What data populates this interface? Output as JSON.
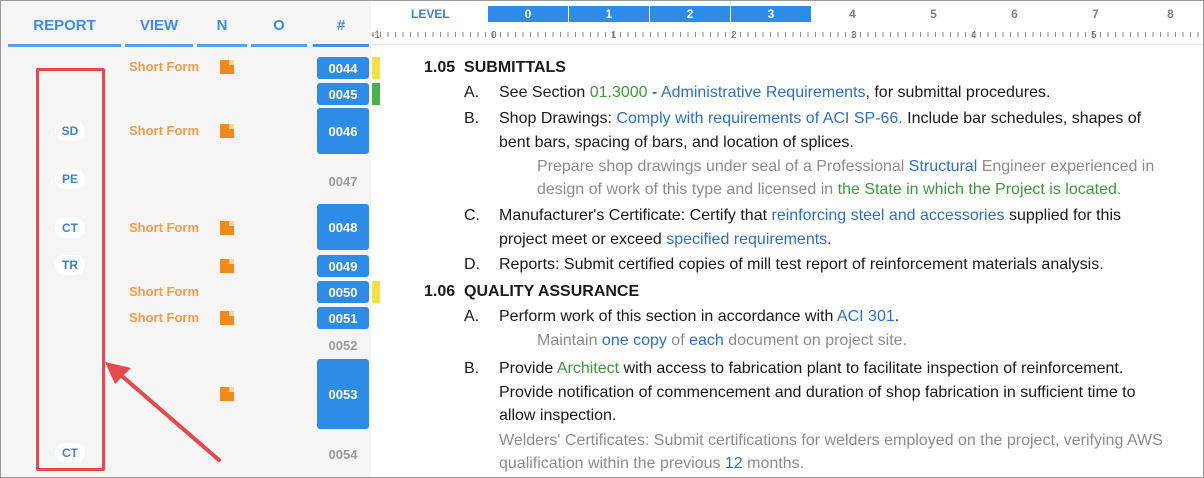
{
  "columns": {
    "report": "REPORT",
    "view": "VIEW",
    "n": "N",
    "o": "O",
    "number": "#"
  },
  "level_bar": {
    "title": "LEVEL",
    "active": [
      "0",
      "1",
      "2",
      "3"
    ],
    "inactive": [
      "4",
      "5",
      "6",
      "7",
      "8"
    ]
  },
  "ruler_labels": [
    "-1",
    "0",
    "1",
    "2",
    "3",
    "4",
    "5"
  ],
  "rows": {
    "r0044": {
      "num": "0044",
      "view": "Short Form",
      "flag": "#f2e24a"
    },
    "r0045": {
      "num": "0045",
      "flag": "#4cae4c"
    },
    "r0046": {
      "num": "0046",
      "report": "SD",
      "view": "Short Form"
    },
    "r0047": {
      "num": "0047",
      "report": "PE"
    },
    "r0048": {
      "num": "0048",
      "report": "CT",
      "view": "Short Form"
    },
    "r0049": {
      "num": "0049",
      "report": "TR"
    },
    "r0050": {
      "num": "0050",
      "view": "Short Form",
      "flag": "#f2e24a"
    },
    "r0051": {
      "num": "0051",
      "view": "Short Form"
    },
    "r0052": {
      "num": "0052"
    },
    "r0053": {
      "num": "0053"
    },
    "r0054": {
      "num": "0054",
      "report": "CT"
    }
  },
  "doc": {
    "s105": {
      "num": "1.05",
      "title": "SUBMITTALS"
    },
    "a": {
      "letter": "A.",
      "t1": "See Section ",
      "t2": "01.3000",
      "t3": " - ",
      "t4": "Administrative Requirements",
      "t5": ", for submittal procedures."
    },
    "b": {
      "letter": "B.",
      "t1": "Shop Drawings:  ",
      "t2": "Comply with requirements of ACI SP-66.",
      "t3": " Include bar schedules, shapes of",
      "line2": "bent bars, spacing of bars, and location of splices."
    },
    "b_note": {
      "t1": "Prepare shop drawings under seal of a Professional ",
      "t2": "Structural",
      "t3": " Engineer experienced in",
      "l2a": "design of work of this type and licensed in ",
      "l2b": "the State in which the Project is located",
      "l2c": "."
    },
    "c": {
      "letter": "C.",
      "t1": "Manufacturer's Certificate:  Certify that ",
      "t2": "reinforcing steel and accessories",
      "t3": " supplied for this",
      "l2a": "project meet or exceed ",
      "l2b": "specified requirements",
      "l2c": "."
    },
    "d": {
      "letter": "D.",
      "text": "Reports:  Submit certified copies of mill test report of reinforcement materials analysis."
    },
    "s106": {
      "num": "1.06",
      "title": "QUALITY ASSURANCE"
    },
    "qa": {
      "letter": "A.",
      "t1": "Perform work of this section in accordance with ",
      "t2": "ACI 301",
      "t3": "."
    },
    "qa_note": {
      "t1": "Maintain ",
      "t2": "one copy",
      "t3": " of ",
      "t4": "each",
      "t5": " document on project site."
    },
    "qb": {
      "letter": "B.",
      "t1": "Provide ",
      "t2": "Architect",
      "t3": " with access to fabrication plant to facilitate inspection of reinforcement.",
      "l2": "Provide notification of commencement and duration of shop fabrication in sufficient time to",
      "l3": "allow inspection."
    },
    "qb_note": {
      "l1": "Welders' Certificates:  Submit certifications for welders employed on the project, verifying AWS",
      "l2a": "qualification within the previous ",
      "l2b": "12",
      "l2c": " months."
    }
  }
}
